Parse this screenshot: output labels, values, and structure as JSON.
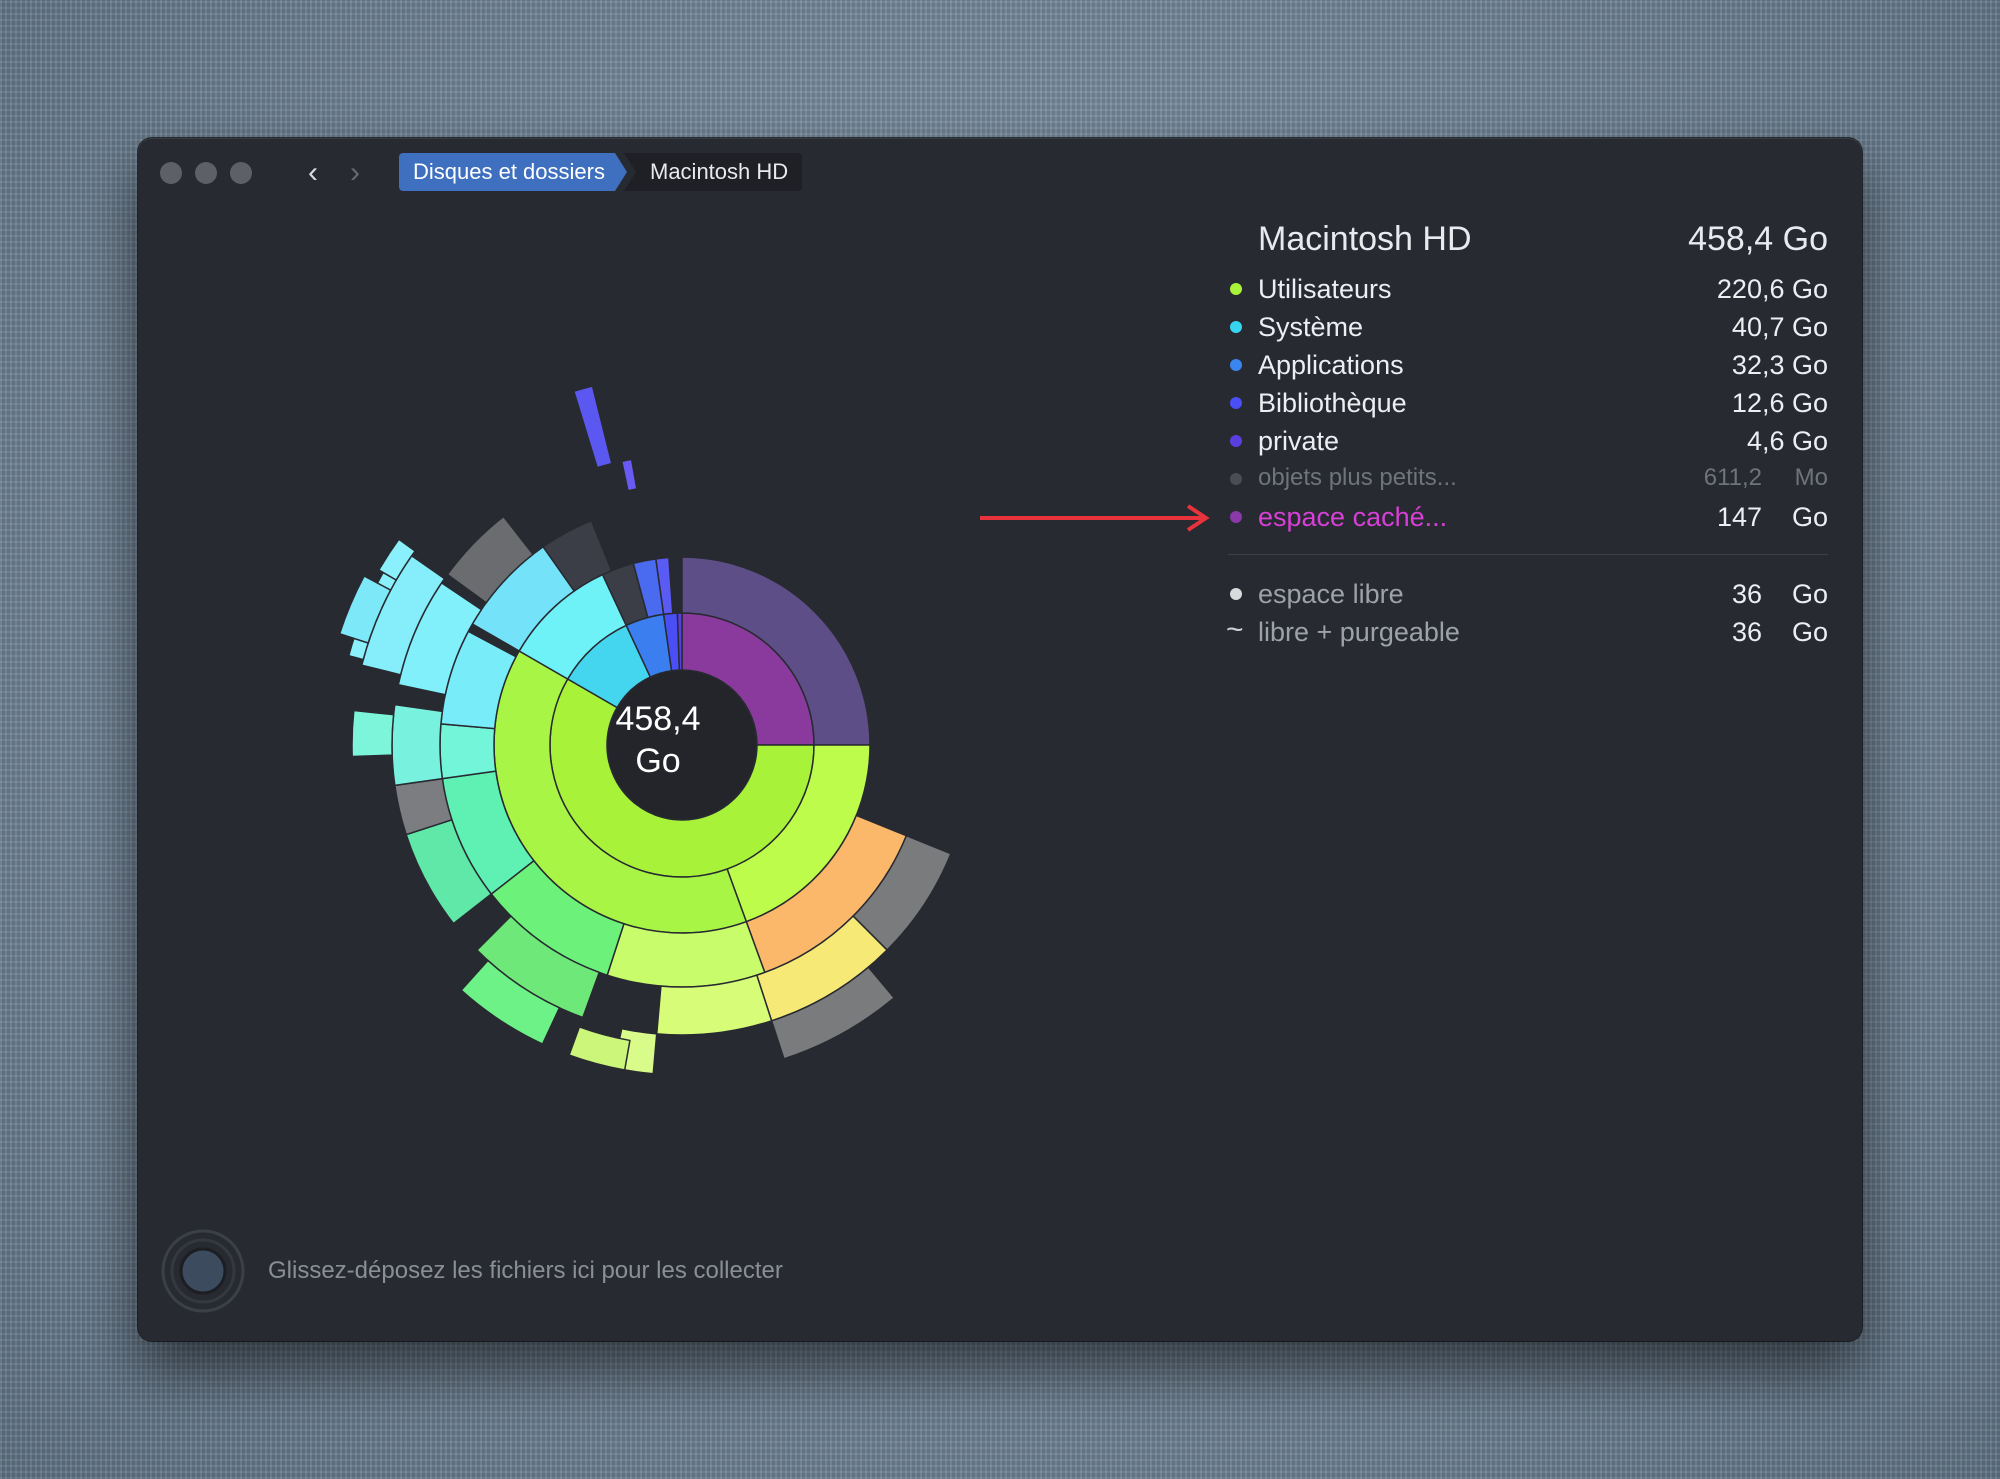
{
  "window": {
    "breadcrumb": [
      "Disques et dossiers",
      "Macintosh HD"
    ],
    "nav_back_icon": "chevron-left-icon",
    "nav_forward_icon": "chevron-right-icon"
  },
  "sunburst": {
    "center_value": "458,4",
    "center_unit": "Go"
  },
  "legend": {
    "title": "Macintosh HD",
    "total": "458,4 Go",
    "items": [
      {
        "label": "Utilisateurs",
        "value": "220,6 Go",
        "color": "#a8f33a"
      },
      {
        "label": "Système",
        "value": "40,7 Go",
        "color": "#38d5f0"
      },
      {
        "label": "Applications",
        "value": "32,3 Go",
        "color": "#3a86f0"
      },
      {
        "label": "Bibliothèque",
        "value": "12,6 Go",
        "color": "#4a4ef5"
      },
      {
        "label": "private",
        "value": "4,6 Go",
        "color": "#5a3fe0"
      },
      {
        "label": "objets plus petits...",
        "value": "611,2",
        "unit": "Mo",
        "color": "#4a4d55"
      },
      {
        "label": "espace caché...",
        "value": "147",
        "unit": "Go",
        "color": "#8a3aa8"
      }
    ],
    "free": [
      {
        "label": "espace libre",
        "value": "36",
        "unit": "Go",
        "marker": "dot"
      },
      {
        "label": "libre + purgeable",
        "value": "36",
        "unit": "Go",
        "marker": "~"
      }
    ]
  },
  "annotation_arrow_color": "#e8323c",
  "footer": {
    "drop_hint": "Glissez-déposez les fichiers ici pour les collecter"
  }
}
